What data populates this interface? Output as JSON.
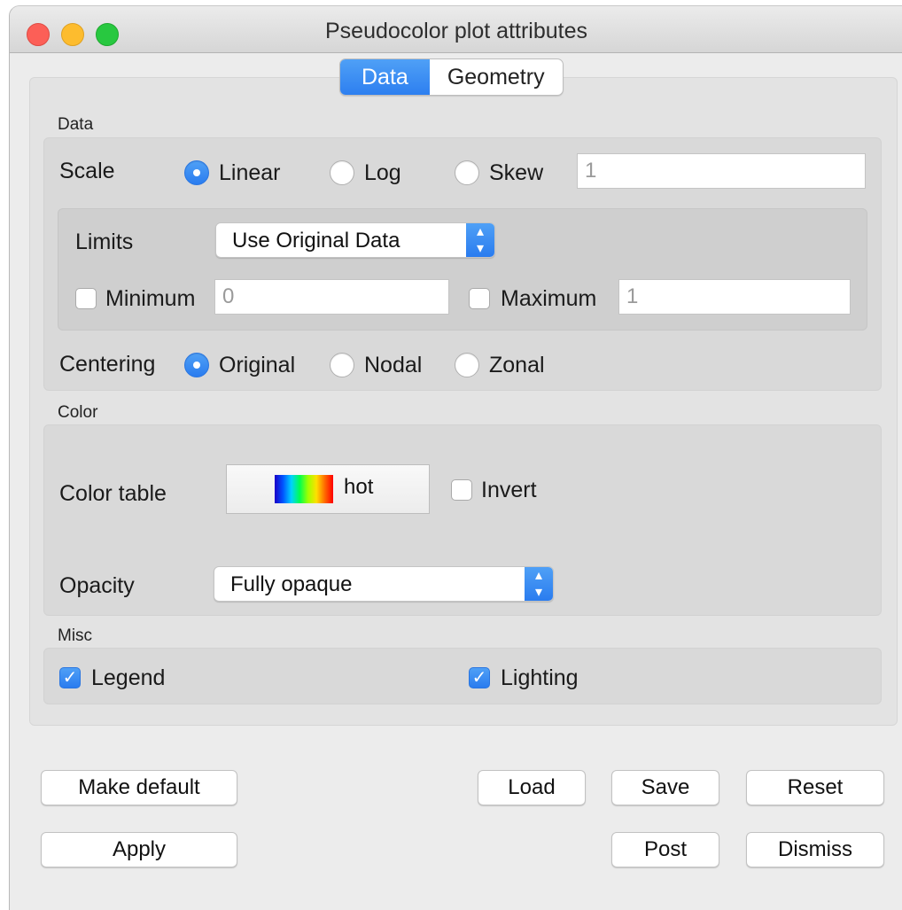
{
  "window": {
    "title": "Pseudocolor plot attributes"
  },
  "tabs": [
    {
      "label": "Data",
      "active": true
    },
    {
      "label": "Geometry",
      "active": false
    }
  ],
  "data_section": {
    "label": "Data",
    "scale_label": "Scale",
    "scale_options": [
      "Linear",
      "Log",
      "Skew"
    ],
    "scale_selected": "Linear",
    "skew_value": "1",
    "limits_label": "Limits",
    "limits_mode": "Use Original Data",
    "minimum_label": "Minimum",
    "minimum_checked": false,
    "minimum_value": "0",
    "maximum_label": "Maximum",
    "maximum_checked": false,
    "maximum_value": "1",
    "centering_label": "Centering",
    "centering_options": [
      "Original",
      "Nodal",
      "Zonal"
    ],
    "centering_selected": "Original"
  },
  "color_section": {
    "label": "Color",
    "color_table_label": "Color table",
    "color_table_name": "hot",
    "invert_label": "Invert",
    "invert_checked": false,
    "opacity_label": "Opacity",
    "opacity_value": "Fully opaque"
  },
  "misc_section": {
    "label": "Misc",
    "legend_label": "Legend",
    "legend_checked": true,
    "lighting_label": "Lighting",
    "lighting_checked": true
  },
  "buttons": {
    "make_default": "Make default",
    "load": "Load",
    "save": "Save",
    "reset": "Reset",
    "apply": "Apply",
    "post": "Post",
    "dismiss": "Dismiss"
  },
  "colors": {
    "accent": "#2d7ff0",
    "close": "#fc5f57",
    "minimize": "#fdbc2e",
    "maximize": "#28c840"
  }
}
